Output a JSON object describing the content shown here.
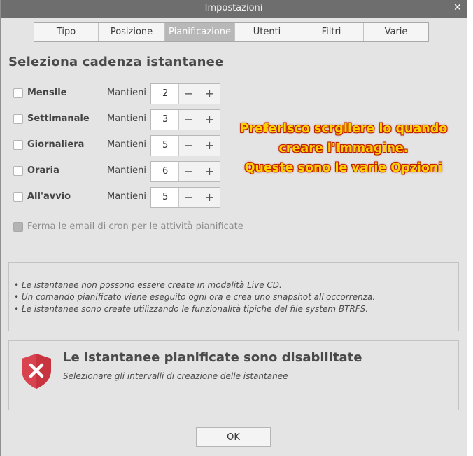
{
  "window": {
    "title": "Impostazioni"
  },
  "tabs": [
    {
      "label": "Tipo",
      "active": false
    },
    {
      "label": "Posizione",
      "active": false
    },
    {
      "label": "Pianificazione",
      "active": true
    },
    {
      "label": "Utenti",
      "active": false
    },
    {
      "label": "Filtri",
      "active": false
    },
    {
      "label": "Varie",
      "active": false
    }
  ],
  "heading": "Seleziona cadenza istantanee",
  "schedule": {
    "keep_label": "Mantieni",
    "rows": [
      {
        "label": "Mensile",
        "checked": false,
        "value": "2"
      },
      {
        "label": "Settimanale",
        "checked": false,
        "value": "3"
      },
      {
        "label": "Giornaliera",
        "checked": false,
        "value": "5"
      },
      {
        "label": "Oraria",
        "checked": false,
        "value": "6"
      },
      {
        "label": "All'avvio",
        "checked": false,
        "value": "5"
      }
    ],
    "minus": "−",
    "plus": "+"
  },
  "cron": {
    "label": "Ferma le email di cron per le attività pianificate",
    "disabled": true
  },
  "annotation": {
    "line1": "Preferisco scrgliere io quando",
    "line2": "creare l'Immagine.",
    "line3": "Queste sono le varie Opzioni"
  },
  "notes": [
    "• Le istantanee non possono essere create in modalità Live CD.",
    "• Un comando pianificato viene eseguito ogni ora e crea uno snapshot all'occorrenza.",
    "• Le istantanee sono create utilizzando le funzionalità tipiche del file system BTRFS."
  ],
  "status": {
    "title": "Le istantanee pianificate sono disabilitate",
    "subtitle": "Selezionare gli intervalli di creazione delle istantanee",
    "icon": "shield-error-icon",
    "color": "#d9434f"
  },
  "ok_label": "OK"
}
